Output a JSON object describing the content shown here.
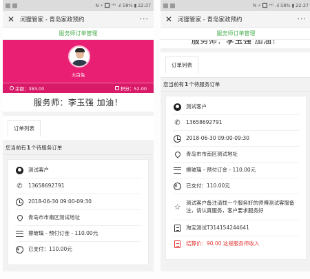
{
  "status_bar": {
    "text": "N ⚡ 🔲 ᴴᴰ .ıl 58% ▮ 22:37"
  },
  "title_bar": {
    "close": "✕",
    "title": "河狸管家 - 青岛家政预约",
    "more": "···"
  },
  "green_header": "服务师订单管理",
  "profile": {
    "name": "大白兔",
    "balance": "余额：383.00",
    "points": "积分：52.00"
  },
  "greeting": "服务师：李玉强 加油！",
  "tab_label": "订单列表",
  "order_count": {
    "prefix": "您当前有",
    "count": "1",
    "suffix": "个待服务订单"
  },
  "order": {
    "customer": "测试客户",
    "phone": "13658692791",
    "time": "2018-06-30 09:00-09:30",
    "address": "青岛市市南区测试地址",
    "service": "擦玻璃 - 预付订金 - 110.00元",
    "paid": "已支付：110.00元",
    "note": "测试客户备注请找一个服务好的师傅测试客服备注，请认真服务，客户要求服务好",
    "taobao": "淘宝测试T314154244641",
    "settlement": "结算价：90.00 这是服务师收入"
  },
  "colors": {
    "brand_pink": "#e91f73",
    "accent_green": "#4caf50",
    "alert_red": "#e53935"
  }
}
